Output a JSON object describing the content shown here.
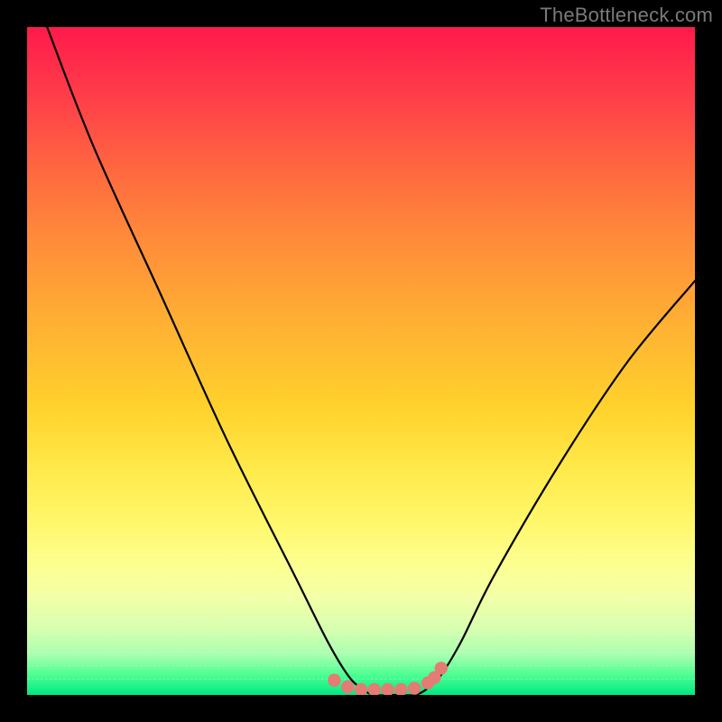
{
  "watermark": "TheBottleneck.com",
  "chart_data": {
    "type": "line",
    "title": "",
    "xlabel": "",
    "ylabel": "",
    "xlim": [
      0,
      100
    ],
    "ylim": [
      0,
      100
    ],
    "series": [
      {
        "name": "bottleneck-curve",
        "x": [
          3,
          10,
          20,
          30,
          40,
          45,
          48,
          50,
          52,
          55,
          58,
          60,
          62,
          65,
          70,
          80,
          90,
          100
        ],
        "y": [
          100,
          82,
          60,
          38,
          18,
          8,
          3,
          1,
          0,
          0,
          0,
          1,
          3,
          8,
          18,
          35,
          50,
          62
        ]
      }
    ],
    "markers": {
      "name": "highlight-dots",
      "x": [
        46,
        48,
        50,
        52,
        54,
        56,
        58,
        60,
        61,
        62
      ],
      "y": [
        2.2,
        1.2,
        0.8,
        0.8,
        0.8,
        0.8,
        1.0,
        1.8,
        2.6,
        4.0
      ]
    },
    "colors": {
      "curve": "#000000",
      "marker": "#e47b74",
      "gradient_top": "#ff1a4b",
      "gradient_bottom": "#00e882"
    }
  }
}
